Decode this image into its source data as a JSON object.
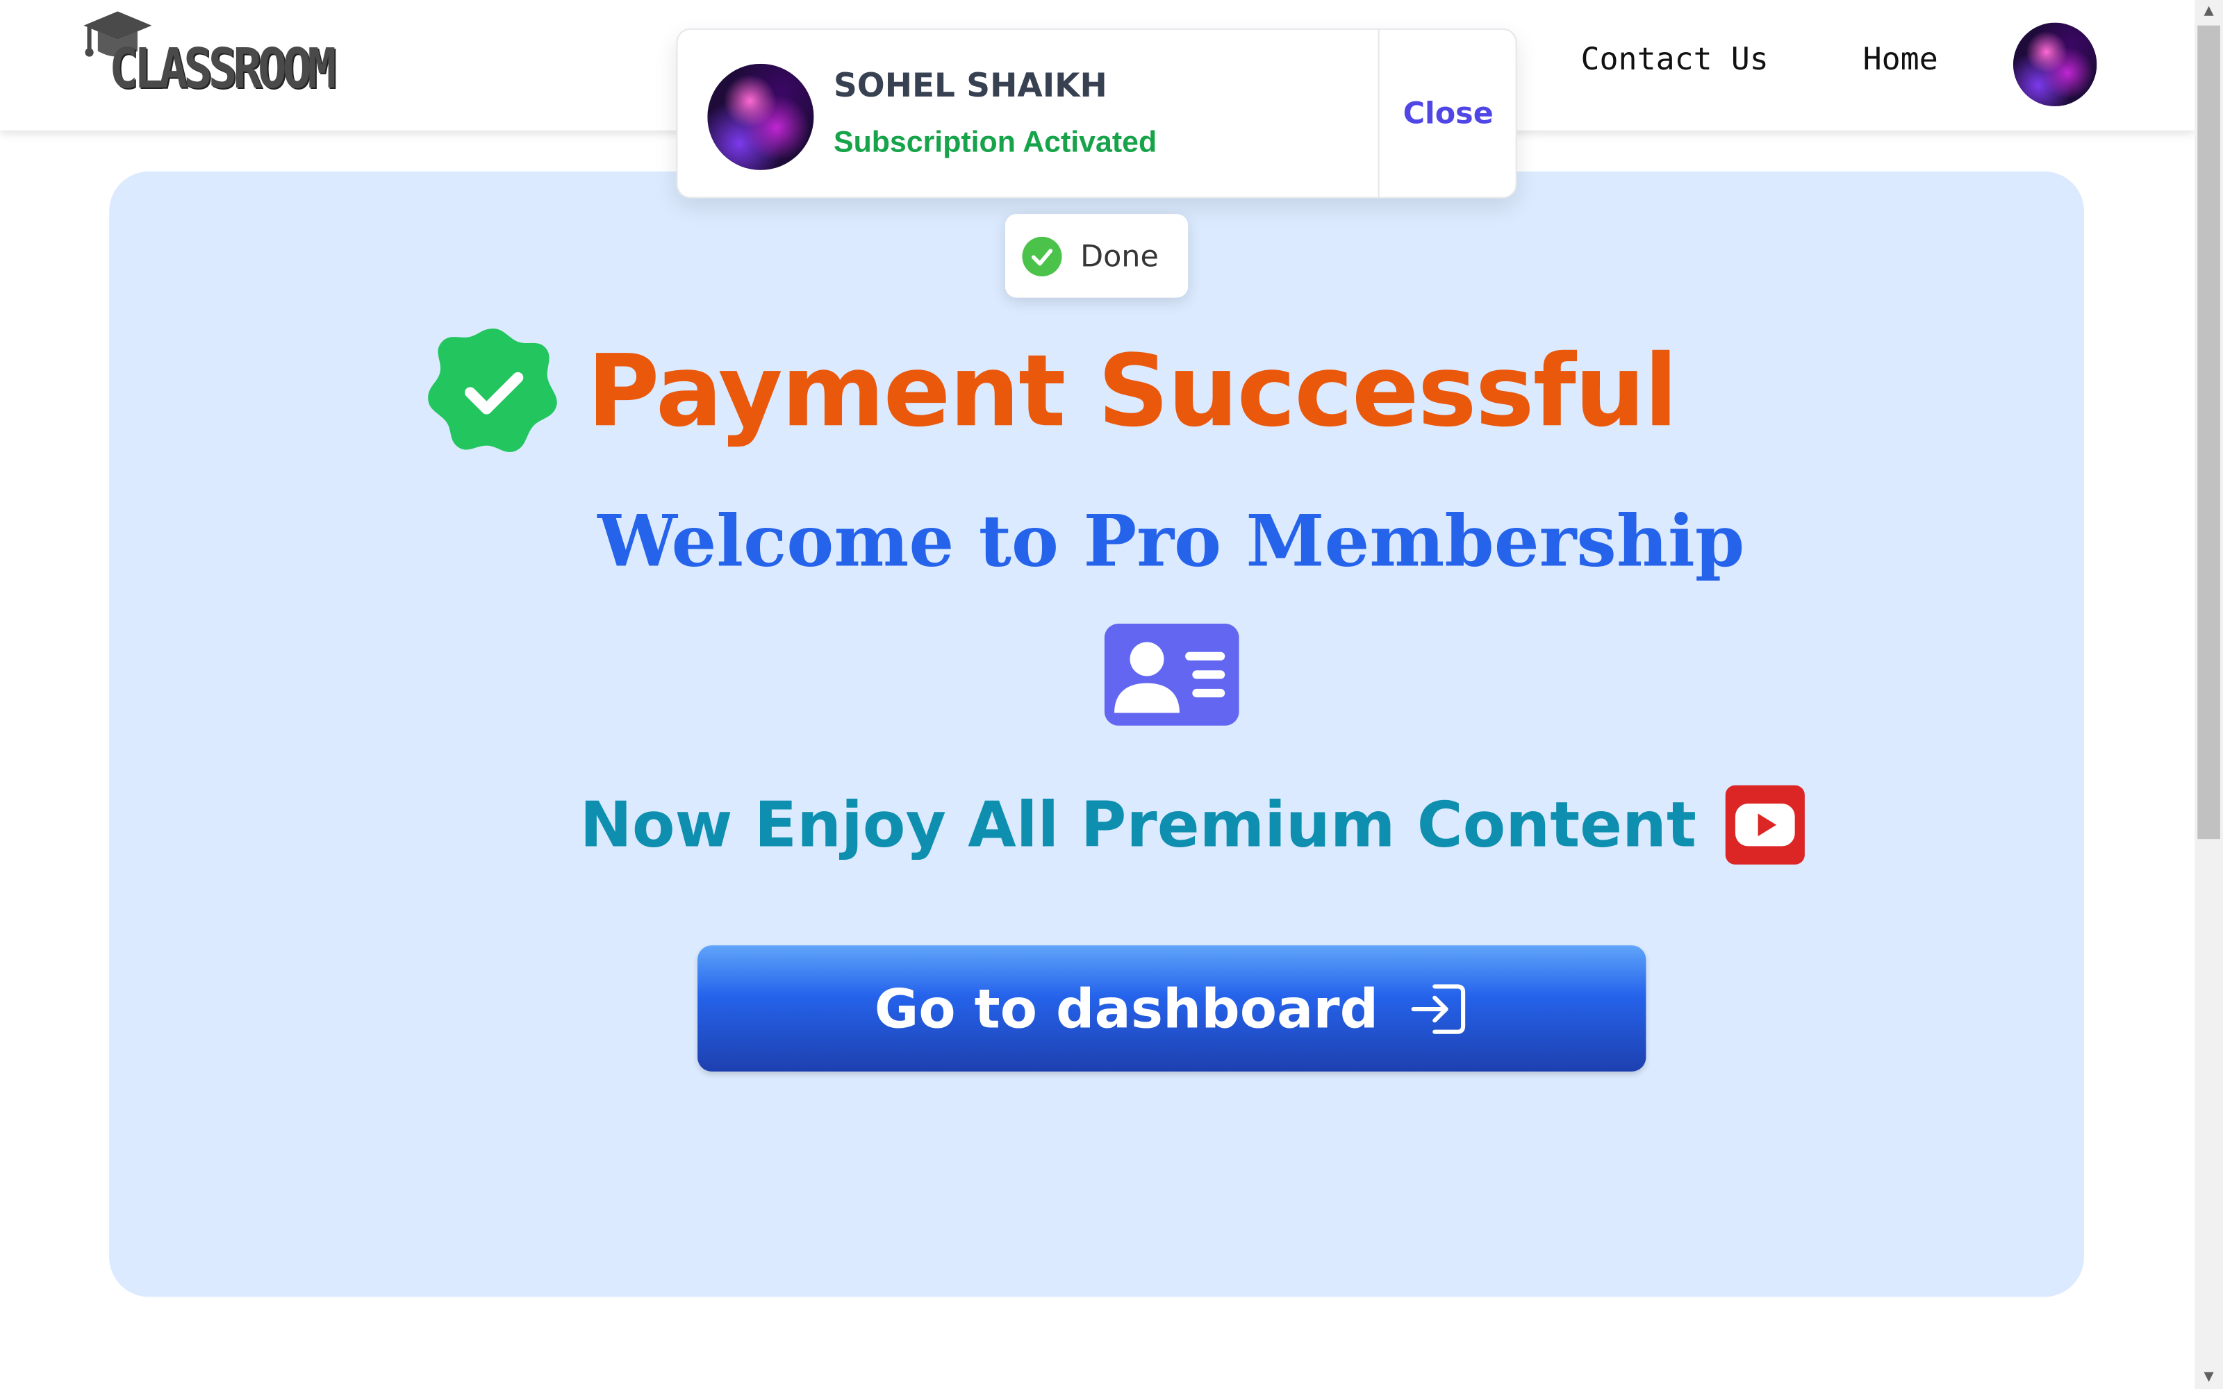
{
  "app": {
    "logo_text": "CLASSROOM"
  },
  "nav": {
    "links": [
      {
        "label": "Contact Us"
      },
      {
        "label": "Home"
      }
    ]
  },
  "notification": {
    "user_name": "SOHEL SHAIKH",
    "status": "Subscription Activated",
    "close_label": "Close"
  },
  "toast": {
    "message": "Done",
    "icon": "check-circle-icon"
  },
  "main": {
    "headline": "Payment Successful",
    "subheadline": "Welcome to Pro Membership",
    "tagline": "Now Enjoy All Premium Content",
    "cta_label": "Go to dashboard"
  },
  "icons": {
    "headline": "verified-badge-icon",
    "membership": "id-card-icon",
    "content": "youtube-icon",
    "cta": "login-icon"
  },
  "colors": {
    "headline": "#ea580c",
    "subheadline": "#2563eb",
    "tagline": "#0e8fb0",
    "card_background": "#dbeafe",
    "badge": "#22c55e",
    "id_card": "#6366f1",
    "youtube": "#dc2626",
    "status": "#16a34a",
    "close": "#4f46e5"
  }
}
